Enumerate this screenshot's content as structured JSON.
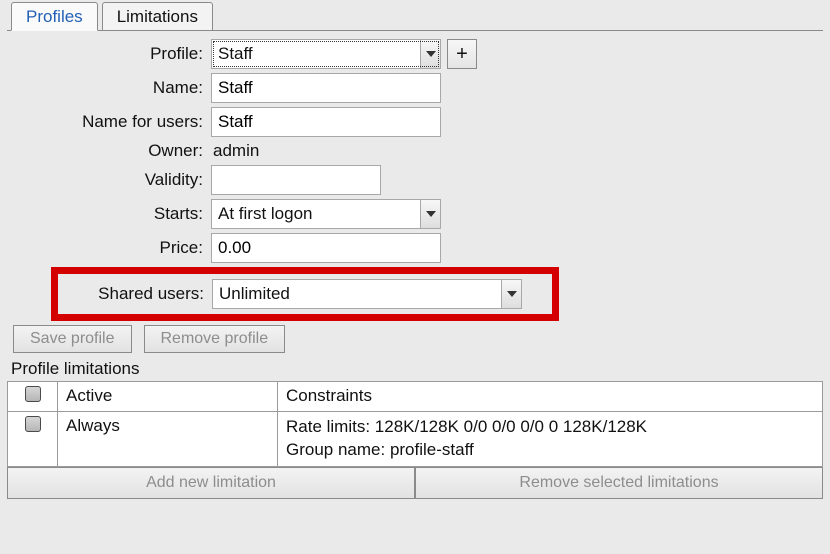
{
  "tabs": {
    "profiles": "Profiles",
    "limitations": "Limitations"
  },
  "labels": {
    "profile": "Profile:",
    "name": "Name:",
    "name_for_users": "Name for users:",
    "owner": "Owner:",
    "validity": "Validity:",
    "starts": "Starts:",
    "price": "Price:",
    "shared_users": "Shared users:"
  },
  "values": {
    "profile_select": "Staff",
    "name": "Staff",
    "name_for_users": "Staff",
    "owner": "admin",
    "validity": "",
    "starts": "At first logon",
    "price": "0.00",
    "shared_users": "Unlimited"
  },
  "buttons": {
    "add_profile": "+",
    "save_profile": "Save profile",
    "remove_profile": "Remove profile",
    "add_limitation": "Add new limitation",
    "remove_limitation": "Remove selected limitations"
  },
  "limitations": {
    "section_title": "Profile limitations",
    "headers": {
      "active": "Active",
      "constraints": "Constraints"
    },
    "rows": [
      {
        "active": "Always",
        "constraints_line1": "Rate limits: 128K/128K 0/0 0/0 0/0 0 128K/128K",
        "constraints_line2": "Group name: profile-staff"
      }
    ]
  }
}
